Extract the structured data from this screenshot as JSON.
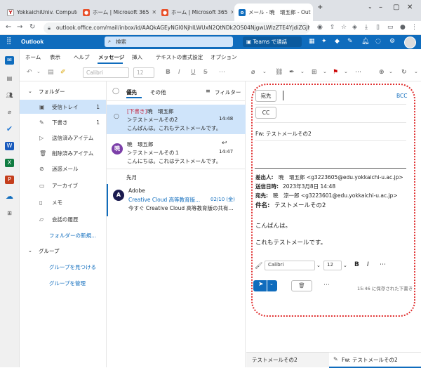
{
  "browser": {
    "tabs": [
      {
        "label": "YokkaichiUniv. Compute",
        "icon": "yu-favicon"
      },
      {
        "label": "ホーム | Microsoft 365",
        "icon": "m365-favicon"
      },
      {
        "label": "ホーム | Microsoft 365",
        "icon": "m365-favicon"
      },
      {
        "label": "メール - 暁　環五郎 - Out",
        "icon": "outlook-favicon"
      }
    ],
    "new_tab": "+",
    "url": "outlook.office.com/mail/inbox/id/AAQkAGEyNGI0NjhlLWUxN2QtNDk2OS04NjgwLWIzZTE4YjdiZGJhY..."
  },
  "outlook": {
    "app_name": "Outlook",
    "search_placeholder": "検索",
    "teams_button": "Teams で通話",
    "brand_color": "#0f6cbd"
  },
  "ribbon": {
    "tabs": [
      "ホーム",
      "表示",
      "ヘルプ",
      "メッセージ",
      "挿入",
      "テキストの書式設定",
      "オプション"
    ],
    "font_name": "Calibri",
    "font_size": "12"
  },
  "folders": {
    "root_label": "フォルダー",
    "items": [
      {
        "label": "受信トレイ",
        "count": "1",
        "icon": "inbox-icon"
      },
      {
        "label": "下書き",
        "count": "1",
        "icon": "pencil-icon"
      },
      {
        "label": "送信済みアイテム",
        "count": "",
        "icon": "send-icon"
      },
      {
        "label": "削除済みアイテム",
        "count": "",
        "icon": "trash-icon"
      },
      {
        "label": "迷惑メール",
        "count": "",
        "icon": "junk-icon"
      },
      {
        "label": "アーカイブ",
        "count": "",
        "icon": "archive-icon"
      },
      {
        "label": "メモ",
        "count": "",
        "icon": "note-icon"
      },
      {
        "label": "会話の履歴",
        "count": "",
        "icon": "folder-icon"
      }
    ],
    "new_folder": "フォルダーの新規...",
    "groups_label": "グループ",
    "find_groups": "グループを見つける",
    "manage_groups": "グループを管理"
  },
  "message_list": {
    "tab_focused": "優先",
    "tab_other": "その他",
    "filter_label": "フィルター",
    "messages": [
      {
        "draft_tag": "[下書き]",
        "sender": "暁　環五郎",
        "subject": "＞テストメールその2",
        "time": "14:48",
        "preview": "こんばんは。これもテストメールです。"
      },
      {
        "avatar": "暁",
        "sender": "暁　環五郎",
        "subject": "＞テストメールその１",
        "time": "14:47",
        "preview": "こんにちは。これはテストメールです。"
      }
    ],
    "section_label": "先月",
    "adobe": {
      "avatar": "A",
      "sender": "Adobe",
      "subject": "Creative Cloud 高等教育版...",
      "date": "02/10 (金)",
      "preview": "今すぐ Creative Cloud 高等教育版の共有..."
    }
  },
  "compose": {
    "to_label": "宛先",
    "cc_label": "CC",
    "bcc_label": "BCC",
    "subject": "Fw: テストメールその2",
    "from_line_label": "差出人:",
    "from_line_value": "暁　環五郎 <g3223605@edu.yokkaichi-u.ac.jp>",
    "sent_label": "送信日時:",
    "sent_value": "2023年3月8日 14:48",
    "to_line_label": "宛先:",
    "to_line_value": "暁　涼一郎 <g3223601@edu.yokkaichi-u.ac.jp>",
    "subject_line_label": "件名:",
    "subject_line_value": "テストメールその2",
    "body_1": "こんばんは。",
    "body_2": "これもテストメールです。",
    "font_name": "Calibri",
    "font_size": "12",
    "saved_status": "15:46 に保存された下書き"
  },
  "draft_tabs": [
    "テストメールその2",
    "Fw: テストメールその2"
  ]
}
